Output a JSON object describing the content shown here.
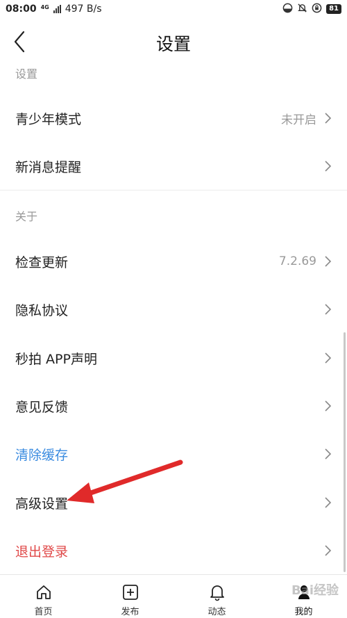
{
  "status_bar": {
    "time": "08:00",
    "network": "4G",
    "speed": "497 B/s",
    "battery": "81"
  },
  "header": {
    "title": "设置"
  },
  "sections": [
    {
      "title": "设置",
      "items": [
        {
          "label": "青少年模式",
          "value": "未开启"
        },
        {
          "label": "新消息提醒",
          "value": ""
        }
      ]
    },
    {
      "title": "关于",
      "items": [
        {
          "label": "检查更新",
          "value": "7.2.69"
        },
        {
          "label": "隐私协议",
          "value": ""
        },
        {
          "label": "秒拍 APP声明",
          "value": ""
        },
        {
          "label": "意见反馈",
          "value": ""
        },
        {
          "label": "清除缓存",
          "value": "",
          "color": "#3a8be0"
        },
        {
          "label": "高级设置",
          "value": ""
        },
        {
          "label": "退出登录",
          "value": "",
          "color": "#e04848"
        }
      ]
    }
  ],
  "annotation": {
    "arrow_color": "#e02a2a"
  },
  "bottom_nav": [
    {
      "label": "首页",
      "icon": "home-icon"
    },
    {
      "label": "发布",
      "icon": "add-square-icon"
    },
    {
      "label": "动态",
      "icon": "bell-icon"
    },
    {
      "label": "我的",
      "icon": "profile-icon",
      "active": true
    }
  ],
  "watermark": "Bai经验"
}
